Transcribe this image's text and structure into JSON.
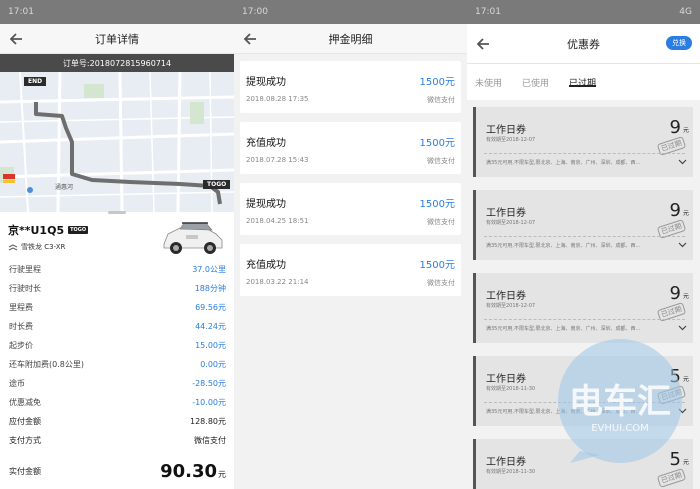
{
  "order": {
    "status_time": "17:01",
    "title": "订单详情",
    "order_no": "订单号:2018072815960714",
    "map": {
      "pin_end": "END",
      "pin_togo": "TOGO",
      "place": "通惠河"
    },
    "plate": "京**U1Q5",
    "tag": "TOGO",
    "model": "雪铁龙 C3-XR",
    "rows": [
      {
        "k": "行驶里程",
        "v": "37.0公里"
      },
      {
        "k": "行驶时长",
        "v": "188分钟"
      },
      {
        "k": "里程费",
        "v": "69.56元"
      },
      {
        "k": "时长费",
        "v": "44.24元"
      },
      {
        "k": "起步价",
        "v": "15.00元"
      },
      {
        "k": "还车附加费(0.8公里)",
        "v": "0.00元"
      },
      {
        "k": "途币",
        "v": "-28.50元"
      },
      {
        "k": "优惠减免",
        "v": "-10.00元"
      },
      {
        "k": "应付金额",
        "v": "128.80元"
      },
      {
        "k": "支付方式",
        "v": "微信支付"
      }
    ],
    "total_label": "实付金额",
    "total_amount": "90.30",
    "total_unit": "元"
  },
  "deposit": {
    "status_time": "17:00",
    "title": "押金明细",
    "items": [
      {
        "type": "提现成功",
        "amount": "1500元",
        "date": "2018.08.28 17:35",
        "method": "微信支付"
      },
      {
        "type": "充值成功",
        "amount": "1500元",
        "date": "2018.07.28 15:43",
        "method": "微信支付"
      },
      {
        "type": "提现成功",
        "amount": "1500元",
        "date": "2018.04.25 18:51",
        "method": "微信支付"
      },
      {
        "type": "充值成功",
        "amount": "1500元",
        "date": "2018.03.22 21:14",
        "method": "微信支付"
      }
    ]
  },
  "coupons": {
    "status_time": "17:01",
    "status_net": "4G",
    "title": "优惠券",
    "swap_label": "兑换",
    "tabs": [
      "未使用",
      "已使用",
      "已过期"
    ],
    "active_tab": 2,
    "items": [
      {
        "name": "工作日券",
        "exp": "有效期至2018-12-07",
        "value": "9",
        "unit": "元",
        "stamp": "已过期",
        "desc": "满35元可用,不限车型,限北京、上海、南京、广州、深圳、成都、西..."
      },
      {
        "name": "工作日券",
        "exp": "有效期至2018-12-07",
        "value": "9",
        "unit": "元",
        "stamp": "已过期",
        "desc": "满35元可用,不限车型,限北京、上海、南京、广州、深圳、成都、西..."
      },
      {
        "name": "工作日券",
        "exp": "有效期至2018-12-07",
        "value": "9",
        "unit": "元",
        "stamp": "已过期",
        "desc": "满35元可用,不限车型,限北京、上海、南京、广州、深圳、成都、西..."
      },
      {
        "name": "工作日券",
        "exp": "有效期至2018-11-30",
        "value": "5",
        "unit": "元",
        "stamp": "已过期",
        "desc": "满35元可用,不限车型,限北京、上海、南京、广州、深圳、成都、西..."
      },
      {
        "name": "工作日券",
        "exp": "有效期至2018-11-30",
        "value": "5",
        "unit": "元",
        "stamp": "已过期",
        "desc": ""
      }
    ]
  },
  "watermark": {
    "text": "电车汇",
    "url": "EVHUI.COM"
  }
}
